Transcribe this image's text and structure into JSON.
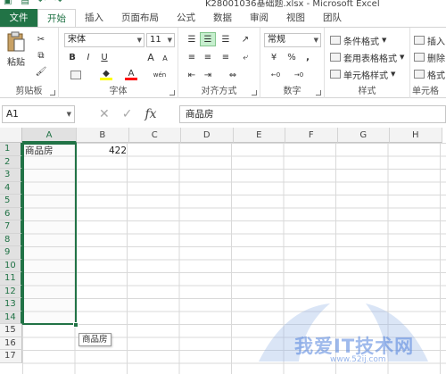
{
  "window": {
    "title": "K28001036基础题.xlsx - Microsoft Excel"
  },
  "tabs": [
    {
      "label": "文件"
    },
    {
      "label": "开始"
    },
    {
      "label": "插入"
    },
    {
      "label": "页面布局"
    },
    {
      "label": "公式"
    },
    {
      "label": "数据"
    },
    {
      "label": "审阅"
    },
    {
      "label": "视图"
    },
    {
      "label": "团队"
    }
  ],
  "ribbon": {
    "clipboard": {
      "paste_label": "粘贴",
      "group_label": "剪贴板"
    },
    "font": {
      "name": "宋体",
      "size": "11",
      "group_label": "字体",
      "bold": "B",
      "italic": "I",
      "underline": "U",
      "font_color_label": "A",
      "grow": "A",
      "shrink": "A",
      "wen": "wén"
    },
    "alignment": {
      "group_label": "对齐方式"
    },
    "number": {
      "format": "常规",
      "group_label": "数字",
      "percent": "%",
      "comma": ","
    },
    "styles": {
      "conditional": "条件格式",
      "table": "套用表格格式",
      "cell": "单元格样式",
      "group_label": "样式"
    },
    "cells": {
      "insert": "插入",
      "delete": "删除",
      "format": "格式",
      "group_label": "单元格"
    }
  },
  "formula_bar": {
    "name_box": "A1",
    "fx": "fx",
    "content": "商品房"
  },
  "columns": [
    "A",
    "B",
    "C",
    "D",
    "E",
    "F",
    "G",
    "H"
  ],
  "rows": [
    "1",
    "2",
    "3",
    "4",
    "5",
    "6",
    "7",
    "8",
    "9",
    "10",
    "11",
    "12",
    "13",
    "14",
    "15",
    "16",
    "17"
  ],
  "cells": {
    "A1": "商品房",
    "B1": "422"
  },
  "autocomplete_tooltip": "商品房",
  "watermark": {
    "text": "我爱IT技术网",
    "url": "www.52ij.com"
  }
}
